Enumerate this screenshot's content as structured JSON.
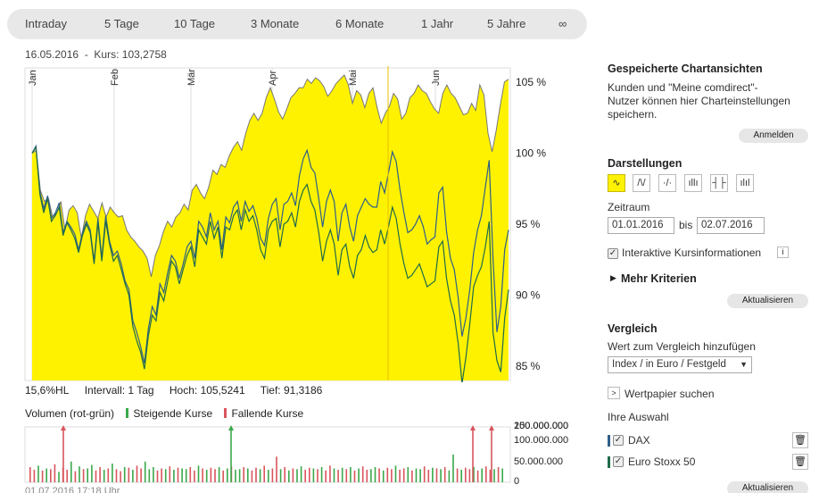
{
  "tabs": [
    "Intraday",
    "5 Tage",
    "10 Tage",
    "3 Monate",
    "6 Monate",
    "1 Jahr",
    "5 Jahre",
    "∞"
  ],
  "info": {
    "date": "16.05.2016",
    "price": "Kurs: 103,2758"
  },
  "stats": {
    "hl": "15,6%HL",
    "interval": "Intervall: 1 Tag",
    "high": "Hoch: 105,5241",
    "low": "Tief: 91,3186"
  },
  "volume_legend": {
    "label": "Volumen (rot-grün)",
    "rising": "Steigende Kurse",
    "falling": "Fallende Kurse"
  },
  "footnote": "01.07.2016 17:18 Uhr",
  "colors": {
    "fill": "#fff200",
    "dax": "#2e5f8a",
    "stoxx": "#1f6b4a",
    "rise": "#3aa84a",
    "fall": "#d9555d"
  },
  "panel": {
    "saved_title": "Gespeicherte Chartansichten",
    "saved_text": [
      "Kunden und \"Meine comdirect\"-",
      "Nutzer können hier Charteinstellungen",
      "speichern."
    ],
    "login_btn": "Anmelden",
    "display_title": "Darstellungen",
    "display_icons": [
      "area-chart-icon",
      "line-chart-icon",
      "dot-line-chart-icon",
      "ohlc-chart-icon",
      "candle-chart-icon",
      "bar-chart-icon"
    ],
    "period_label": "Zeitraum",
    "from": "01.01.2016",
    "to_label": "bis",
    "to": "02.07.2016",
    "interactive_label": "Interaktive Kursinformationen",
    "more_label": "Mehr Kriterien",
    "update_btn": "Aktualisieren",
    "compare_title": "Vergleich",
    "compare_label": "Wert zum Vergleich hinzufügen",
    "compare_select": "Index / in Euro / Festgeld",
    "search_label": "Wertpapier suchen",
    "selection_title": "Ihre Auswahl",
    "selection": [
      {
        "name": "DAX",
        "color": "#2e5f8a"
      },
      {
        "name": "Euro Stoxx 50",
        "color": "#1f6b4a"
      }
    ],
    "update_btn2": "Aktualisieren"
  },
  "chart_data": {
    "type": "area",
    "months": [
      "Jan",
      "Feb",
      "Mär",
      "Apr",
      "Mai",
      "Jun"
    ],
    "y_ticks": [
      "105 %",
      "100 %",
      "95 %",
      "90 %",
      "85 %"
    ],
    "ylim": [
      84,
      106
    ],
    "vol_ticks": [
      "200.000.000",
      "150.000.000",
      "100.000.000",
      "50.000.000",
      "0"
    ],
    "series": [
      {
        "name": "Kurs",
        "values": [
          100,
          100.2,
          97.4,
          96.6,
          96.8,
          95.5,
          95.8,
          96.6,
          94.6,
          96.0,
          96.3,
          95.8,
          94.0,
          95.6,
          96.4,
          95.9,
          95.4,
          96.5,
          95.5,
          96.2,
          95.8,
          95.5,
          95.6,
          94.6,
          94.1,
          93.8,
          93.4,
          93.1,
          92.6,
          91.3,
          92.8,
          93.5,
          94.5,
          95.2,
          94.8,
          95.5,
          95.8,
          96.4,
          96.0,
          97.4,
          97.8,
          97.2,
          96.8,
          97.6,
          98.8,
          98.5,
          99.2,
          99.0,
          99.8,
          100.4,
          100.8,
          100.2,
          101.4,
          102.3,
          102.8,
          102.3,
          102.8,
          103.9,
          104.6,
          103.8,
          102.9,
          102.4,
          103.1,
          103.9,
          104.2,
          104.6,
          104.6,
          105.2,
          104.9,
          105.3,
          105.1,
          104.7,
          104.0,
          104.4,
          104.9,
          105.2,
          105.5,
          104.8,
          103.5,
          104.4,
          104.1,
          103.2,
          104.2,
          104.6,
          103.2,
          102.1,
          102.8,
          103.3,
          104.2,
          103.8,
          102.4,
          102.8,
          103.9,
          104.2,
          104.8,
          104.4,
          104.2,
          103.6,
          103.1,
          102.8,
          104.2,
          104.8,
          104.2,
          103.9,
          103.3,
          102.7,
          102.8,
          103.5,
          103.0,
          104.8,
          104.1,
          101.4,
          100.1,
          101.6,
          103.4,
          105.0,
          105.2
        ]
      },
      {
        "name": "DAX",
        "values": [
          100,
          100.5,
          97.3,
          96.1,
          97.0,
          95.4,
          95.8,
          96.5,
          94.4,
          95.2,
          94.8,
          94.3,
          93.2,
          94.4,
          95.2,
          94.6,
          92.4,
          95.4,
          92.6,
          95.6,
          93.8,
          92.8,
          93.1,
          92.2,
          91.0,
          90.4,
          88.2,
          87.4,
          86.4,
          85.2,
          87.6,
          89.2,
          88.6,
          90.8,
          90.2,
          91.6,
          92.8,
          92.4,
          91.2,
          92.2,
          93.4,
          93.8,
          92.6,
          95.2,
          94.8,
          94.1,
          95.8,
          94.6,
          95.2,
          93.2,
          95.5,
          95.1,
          96.2,
          96.6,
          95.2,
          96.6,
          95.9,
          96.3,
          95.4,
          94.0,
          93.5,
          95.4,
          96.4,
          96.8,
          94.6,
          96.4,
          96.6,
          97.2,
          96.3,
          98.4,
          99.6,
          100.2,
          99.0,
          98.6,
          96.8,
          94.8,
          96.6,
          97.4,
          96.6,
          93.8,
          95.8,
          96.4,
          94.8,
          93.8,
          95.6,
          96.2,
          96.8,
          96.4,
          96.2,
          96.2,
          98.0,
          97.2,
          98.6,
          100.1,
          99.4,
          97.4,
          95.8,
          94.4,
          94.6,
          95.0,
          95.6,
          94.8,
          93.6,
          93.9,
          94.1,
          97.2,
          97.6,
          94.5,
          92.6,
          91.8,
          89.8,
          87.1,
          88.4,
          90.4,
          93.0,
          94.6,
          95.6,
          97.6,
          99.5,
          92.6,
          87.4,
          89.2,
          93.2,
          94.6
        ]
      },
      {
        "name": "Euro Stoxx 50",
        "values": [
          100,
          100.4,
          97.1,
          95.8,
          96.8,
          95.2,
          95.6,
          96.2,
          94.2,
          95.1,
          94.6,
          94.0,
          93.0,
          94.2,
          95.0,
          94.4,
          92.2,
          95.1,
          92.4,
          95.2,
          93.6,
          92.4,
          92.8,
          91.8,
          90.8,
          90.0,
          87.8,
          86.8,
          86.0,
          84.8,
          87.1,
          88.6,
          88.2,
          90.2,
          89.6,
          91.0,
          92.4,
          92.0,
          90.8,
          91.8,
          92.8,
          93.4,
          92.0,
          94.6,
          94.1,
          93.6,
          95.2,
          94.0,
          94.8,
          92.6,
          94.8,
          94.6,
          95.6,
          96.0,
          94.6,
          96.0,
          95.2,
          95.6,
          94.6,
          93.2,
          92.6,
          94.6,
          95.2,
          95.4,
          93.4,
          95.0,
          95.2,
          95.8,
          94.8,
          96.6,
          97.4,
          97.8,
          96.6,
          96.0,
          94.4,
          92.4,
          93.8,
          94.6,
          93.6,
          91.4,
          93.2,
          93.6,
          92.0,
          91.2,
          92.8,
          93.2,
          94.2,
          93.4,
          93.0,
          93.2,
          94.6,
          93.6,
          94.8,
          96.2,
          95.4,
          93.6,
          92.2,
          91.2,
          91.4,
          91.8,
          92.2,
          91.4,
          90.6,
          90.8,
          91.0,
          93.4,
          93.8,
          91.2,
          89.6,
          88.6,
          86.6,
          83.8,
          85.6,
          88.0,
          90.6,
          91.4,
          92.0,
          93.4,
          95.2,
          87.4,
          85.4,
          84.6,
          88.4,
          90.4
        ]
      }
    ],
    "volume_signs": "rrgrgrrgrrgrgrggrrgrgrrgrgrrgggrrgrgrggrrgrgrrgrgrggrgrrgrgrrgrgrggrrgrgrrgrgrgrgrrggrgrrgrrgrggrrgrgrggrgrrgrg",
    "volume_values": [
      110,
      90,
      120,
      85,
      100,
      95,
      130,
      75,
      105,
      90,
      150,
      80,
      115,
      95,
      100,
      125,
      85,
      110,
      90,
      100,
      135,
      95,
      80,
      110,
      105,
      90,
      120,
      100,
      150,
      95,
      110,
      85,
      100,
      95,
      115,
      90,
      105,
      100,
      95,
      110,
      85,
      120,
      100,
      90,
      105,
      95,
      110,
      85,
      100,
      115,
      90,
      95,
      110,
      100,
      85,
      105,
      95,
      120,
      90,
      100,
      185,
      95,
      110,
      85,
      100,
      95,
      115,
      90,
      105,
      100,
      95,
      110,
      85,
      120,
      100,
      90,
      105,
      95,
      110,
      85,
      100,
      115,
      90,
      95,
      110,
      100,
      85,
      105,
      95,
      120,
      90,
      100,
      110,
      85,
      100,
      95,
      115,
      90,
      105,
      100,
      95,
      110,
      85,
      200,
      100,
      90,
      105,
      95,
      110,
      85,
      100,
      115,
      90,
      95,
      110,
      100
    ]
  }
}
